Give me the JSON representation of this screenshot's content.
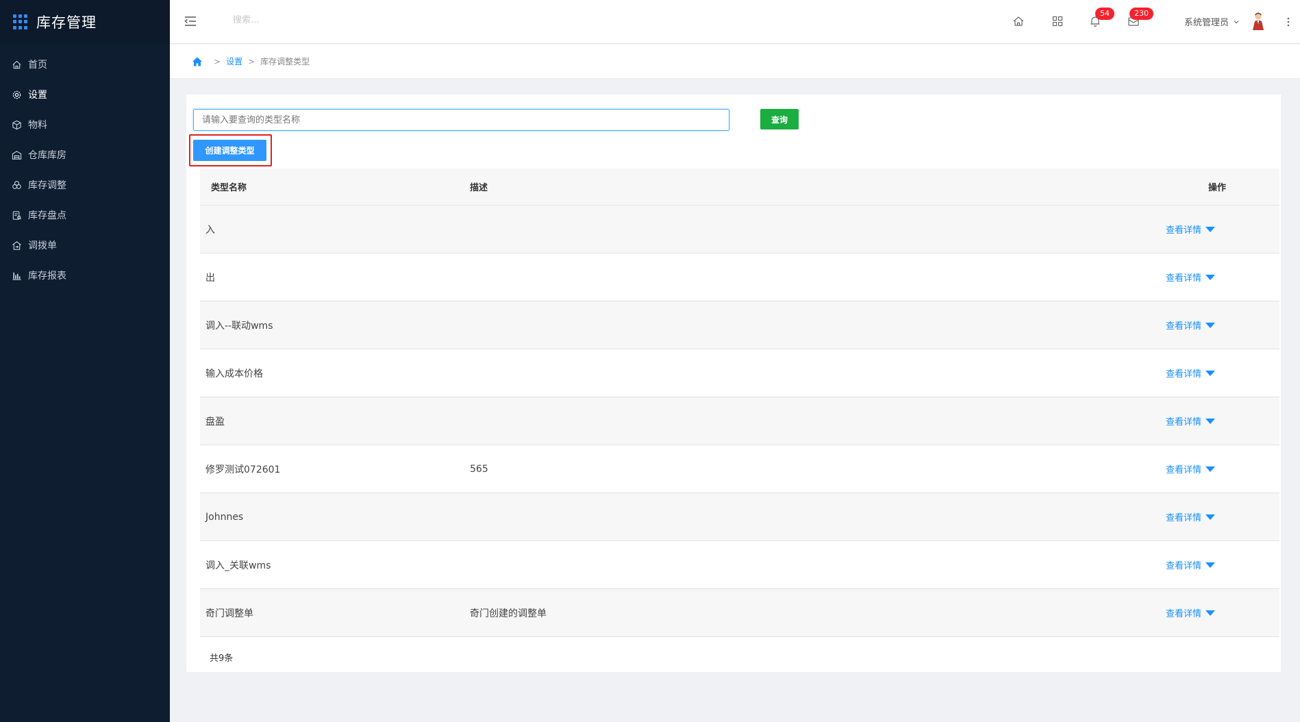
{
  "app": {
    "title": "库存管理"
  },
  "sidebar": {
    "items": [
      {
        "label": "首页",
        "icon": "home-icon",
        "active": false
      },
      {
        "label": "设置",
        "icon": "gear-icon",
        "active": true
      },
      {
        "label": "物料",
        "icon": "box-icon",
        "active": false
      },
      {
        "label": "仓库库房",
        "icon": "warehouse-icon",
        "active": false
      },
      {
        "label": "库存调整",
        "icon": "adjust-icon",
        "active": false
      },
      {
        "label": "库存盘点",
        "icon": "inventory-check-icon",
        "active": false
      },
      {
        "label": "调拨单",
        "icon": "transfer-icon",
        "active": false
      },
      {
        "label": "库存报表",
        "icon": "bar-chart-icon",
        "active": false
      }
    ]
  },
  "header": {
    "search_placeholder": "搜索...",
    "notifications_count": "54",
    "messages_count": "230",
    "user_name": "系统管理员"
  },
  "breadcrumb": {
    "sep": ">",
    "level1": "设置",
    "level2": "库存调整类型"
  },
  "toolbar": {
    "search_placeholder": "请输入要查询的类型名称",
    "query_label": "查询",
    "create_label": "创建调整类型"
  },
  "table": {
    "columns": {
      "name": "类型名称",
      "desc": "描述",
      "op": "操作"
    },
    "rows": [
      {
        "name": "入",
        "desc": "",
        "op": "查看详情"
      },
      {
        "name": "出",
        "desc": "",
        "op": "查看详情"
      },
      {
        "name": "调入--联动wms",
        "desc": "",
        "op": "查看详情"
      },
      {
        "name": "输入成本价格",
        "desc": "",
        "op": "查看详情"
      },
      {
        "name": "盘盈",
        "desc": "",
        "op": "查看详情"
      },
      {
        "name": "修罗测试072601",
        "desc": "565",
        "op": "查看详情"
      },
      {
        "name": "Johnnes",
        "desc": "",
        "op": "查看详情"
      },
      {
        "name": "调入_关联wms",
        "desc": "",
        "op": "查看详情"
      },
      {
        "name": "奇门调整单",
        "desc": "奇门创建的调整单",
        "op": "查看详情"
      }
    ],
    "total": "共9条"
  },
  "colors": {
    "sidebar_bg": "#0e1d30",
    "primary": "#1890ff",
    "query_green": "#1aad3f",
    "badge_red": "#f5222d",
    "highlight_red": "#e0201a"
  }
}
